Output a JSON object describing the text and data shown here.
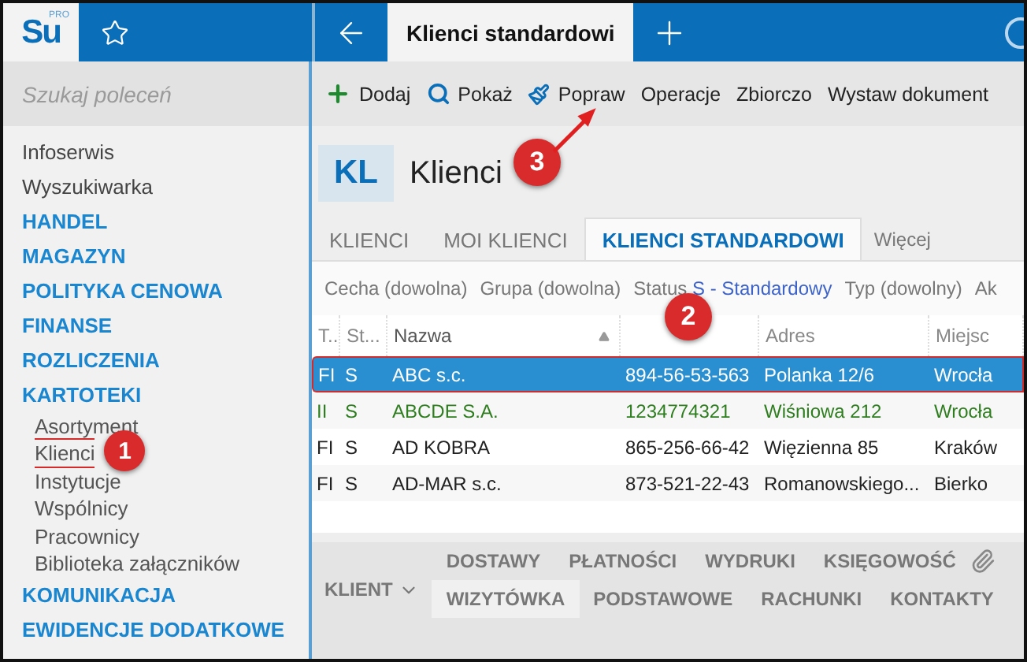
{
  "app": {
    "logo": "Su",
    "logo_badge": "PRO"
  },
  "top_tab": {
    "title": "Klienci standardowi"
  },
  "sidebar": {
    "search": {
      "placeholder": "Szukaj poleceń"
    },
    "items": [
      {
        "label": "Infoserwis",
        "kind": "link"
      },
      {
        "label": "Wyszukiwarka",
        "kind": "link"
      },
      {
        "label": "HANDEL",
        "kind": "section"
      },
      {
        "label": "MAGAZYN",
        "kind": "section"
      },
      {
        "label": "POLITYKA CENOWA",
        "kind": "section"
      },
      {
        "label": "FINANSE",
        "kind": "section"
      },
      {
        "label": "ROZLICZENIA",
        "kind": "section"
      },
      {
        "label": "KARTOTEKI",
        "kind": "section",
        "children": [
          {
            "label": "Asortyment",
            "highlighted": false
          },
          {
            "label": "Klienci",
            "highlighted": true,
            "annotation": "1"
          },
          {
            "label": "Instytucje",
            "highlighted": false
          },
          {
            "label": "Wspólnicy",
            "highlighted": false
          },
          {
            "label": "Pracownicy",
            "highlighted": false
          },
          {
            "label": "Biblioteka załączników",
            "highlighted": false
          }
        ]
      },
      {
        "label": "KOMUNIKACJA",
        "kind": "section"
      },
      {
        "label": "EWIDENCJE DODATKOWE",
        "kind": "section"
      }
    ]
  },
  "toolbar": [
    {
      "label": "Dodaj",
      "kind": "add"
    },
    {
      "label": "Pokaż",
      "kind": "show"
    },
    {
      "label": "Popraw",
      "kind": "edit",
      "annotation": "3"
    },
    {
      "label": "Operacje",
      "kind": "plain"
    },
    {
      "label": "Zbiorczo",
      "kind": "plain"
    },
    {
      "label": "Wystaw dokument",
      "kind": "plain"
    }
  ],
  "header": {
    "code": "KL",
    "title": "Klienci"
  },
  "tabs": [
    {
      "label": "KLIENCI",
      "selected": false
    },
    {
      "label": "MOI KLIENCI",
      "selected": false
    },
    {
      "label": "KLIENCI STANDARDOWI",
      "selected": true
    }
  ],
  "more_tab": "Więcej",
  "filters": [
    {
      "label": "Cecha (dowolna)"
    },
    {
      "label": "Grupa (dowolna)"
    },
    {
      "label": "Status",
      "value": "S - Standardowy"
    },
    {
      "label": "Typ (dowolny)"
    },
    {
      "label": "Ak"
    }
  ],
  "table": {
    "columns": [
      {
        "label": "T..",
        "sorted": false
      },
      {
        "label": "St...",
        "sorted": false
      },
      {
        "label": "Nazwa",
        "sorted": true
      },
      {
        "sorted": false,
        "annotation": "2"
      },
      {
        "label": "Adres",
        "sorted": false
      },
      {
        "label": "Miejsc",
        "sorted": false
      }
    ],
    "rows": [
      {
        "selected": true,
        "highlighted": true,
        "cells": [
          "FI",
          "S",
          "ABC s.c.",
          "894-56-53-563",
          "Polanka  12/6",
          "Wrocła"
        ]
      },
      {
        "selected": false,
        "highlighted": false,
        "color": "#2e7d1f",
        "cells": [
          "II",
          "S",
          "ABCDE S.A.",
          "1234774321",
          "Wiśniowa 212",
          "Wrocła"
        ]
      },
      {
        "selected": false,
        "highlighted": false,
        "color": "#222222",
        "cells": [
          "FI",
          "S",
          "AD KOBRA",
          "865-256-66-42",
          "Więzienna  85",
          "Kraków"
        ]
      },
      {
        "selected": false,
        "highlighted": false,
        "color": "#222222",
        "cells": [
          "FI",
          "S",
          "AD-MAR s.c.",
          "873-521-22-43",
          "Romanowskiego...",
          "Bierko"
        ]
      }
    ]
  },
  "detail": {
    "menu": "KLIENT",
    "upper_tabs": [
      "DOSTAWY",
      "PŁATNOŚCI",
      "WYDRUKI",
      "KSIĘGOWOŚĆ"
    ],
    "lower_tabs": [
      {
        "label": "WIZYTÓWKA",
        "selected": true
      },
      {
        "label": "PODSTAWOWE",
        "selected": false
      },
      {
        "label": "RACHUNKI",
        "selected": false
      },
      {
        "label": "KONTAKTY",
        "selected": false
      }
    ]
  }
}
